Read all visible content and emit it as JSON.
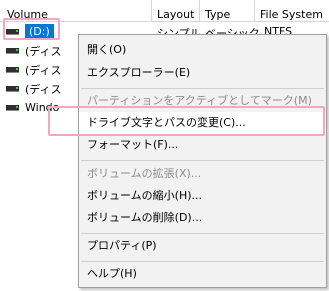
{
  "columns": {
    "volume": "Volume",
    "layout": "Layout",
    "type": "Type",
    "file_system": "File System"
  },
  "volumes": [
    {
      "name": "(D:)",
      "layout": "シンプル",
      "type": "ベーシック",
      "file_system": "NTFS",
      "selected": true
    },
    {
      "name": "(ディス",
      "layout": "",
      "type": "",
      "file_system": ""
    },
    {
      "name": "(ディス",
      "layout": "",
      "type": "",
      "file_system": ""
    },
    {
      "name": "(ディス",
      "layout": "",
      "type": "",
      "file_system": ""
    },
    {
      "name": "Windo",
      "layout": "",
      "type": "",
      "file_system": ""
    }
  ],
  "context_menu": {
    "open": "開く(O)",
    "explorer": "エクスプローラー(E)",
    "mark_active": "パーティションをアクティブとしてマーク(M)",
    "change_drive_letter": "ドライブ文字とパスの変更(C)...",
    "format": "フォーマット(F)...",
    "extend": "ボリュームの拡張(X)...",
    "shrink": "ボリュームの縮小(H)...",
    "delete": "ボリュームの削除(D)...",
    "properties": "プロパティ(P)",
    "help": "ヘルプ(H)"
  },
  "colors": {
    "selection": "#0078d7",
    "highlight_outline": "#f0a8c4",
    "disabled_text": "#8c8c8c",
    "menu_background": "#f2f2f2"
  }
}
